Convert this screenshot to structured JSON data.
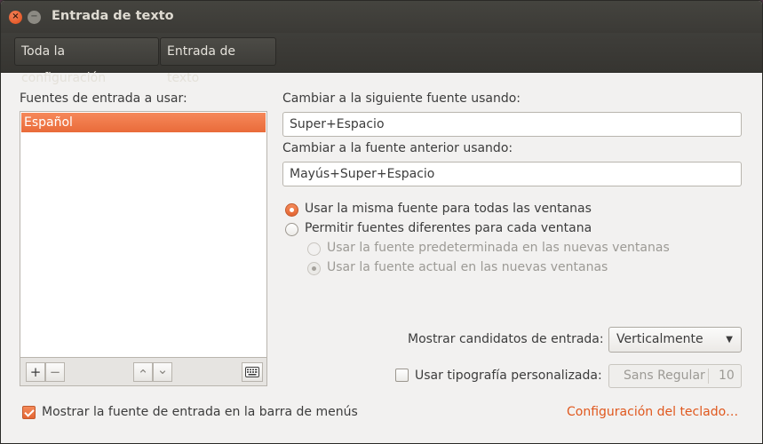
{
  "window": {
    "title": "Entrada de texto",
    "close_glyph": "×",
    "minimize_glyph": "−"
  },
  "breadcrumb": [
    {
      "label": "Toda la configuración"
    },
    {
      "label": "Entrada de texto"
    }
  ],
  "sources": {
    "label": "Fuentes de entrada a usar:",
    "items": [
      "Español"
    ],
    "toolbar": {
      "add": "+",
      "remove": "−",
      "up": "⌃",
      "down": "⌄",
      "keyboard_icon": "keyboard-icon"
    }
  },
  "shortcuts": {
    "next_label": "Cambiar a la siguiente fuente usando:",
    "next_value": "Super+Espacio",
    "prev_label": "Cambiar a la fuente anterior usando:",
    "prev_value": "Mayús+Super+Espacio"
  },
  "mode": {
    "same_label": "Usar la misma fuente para todas las ventanas",
    "different_label": "Permitir fuentes diferentes para cada ventana",
    "default_label": "Usar la fuente predeterminada en las nuevas ventanas",
    "current_label": "Usar la fuente actual en las nuevas ventanas",
    "selected": "same",
    "sub_selected": "current"
  },
  "candidates": {
    "label": "Mostrar candidatos de entrada:",
    "value": "Verticalmente"
  },
  "custom_font": {
    "label": "Usar tipografía personalizada:",
    "checked": false,
    "font_name": "Sans Regular",
    "font_size": "10"
  },
  "show_in_menubar": {
    "label": "Mostrar la fuente de entrada en la barra de menús",
    "checked": true
  },
  "keyboard_settings_link": "Configuración del teclado…",
  "colors": {
    "accent": "#e96b3a",
    "link": "#e0581e",
    "titlebar": "#3b3a36"
  }
}
